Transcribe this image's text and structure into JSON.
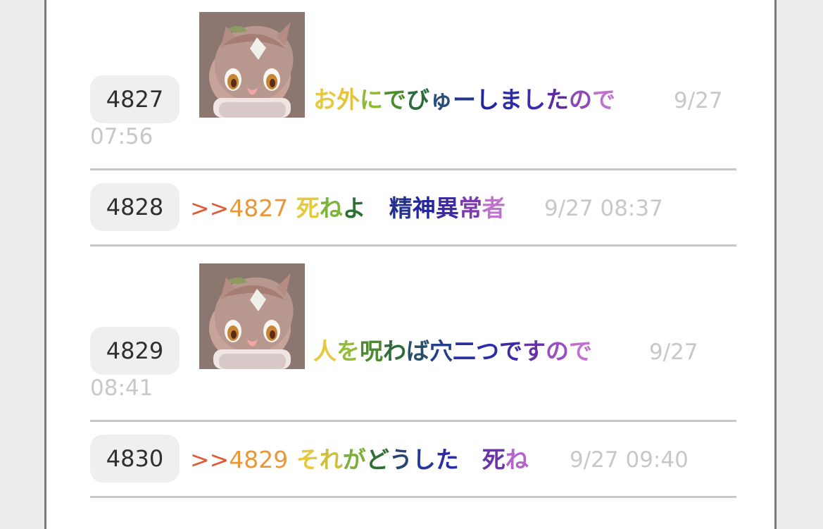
{
  "posts": [
    {
      "number": "4827",
      "text_chars": [
        {
          "t": "お",
          "c": "#e6c93d"
        },
        {
          "t": "外",
          "c": "#e3c43a"
        },
        {
          "t": "に",
          "c": "#8cbc35"
        },
        {
          "t": "で",
          "c": "#4d8d2d"
        },
        {
          "t": "び",
          "c": "#2b6a3a"
        },
        {
          "t": "ゅ",
          "c": "#2a4e7d"
        },
        {
          "t": "ー",
          "c": "#20358f"
        },
        {
          "t": "し",
          "c": "#2424a1"
        },
        {
          "t": "ま",
          "c": "#2c2ca6"
        },
        {
          "t": "し",
          "c": "#3a2ca8"
        },
        {
          "t": "た",
          "c": "#5c2ba2"
        },
        {
          "t": "の",
          "c": "#8e48b8"
        },
        {
          "t": "で",
          "c": "#c070cf"
        }
      ],
      "time_first_line": "9/27",
      "time_second_line": "07:56"
    },
    {
      "number": "4828",
      "reply_prefix": ">>",
      "reply_number": "4827",
      "text_chars": [
        {
          "t": "死",
          "c": "#e6c93d"
        },
        {
          "t": "ね",
          "c": "#7bb33b"
        },
        {
          "t": "よ",
          "c": "#2e6f34"
        },
        {
          "t": "　",
          "c": "#000000"
        },
        {
          "t": "精",
          "c": "#22308c"
        },
        {
          "t": "神",
          "c": "#25279f"
        },
        {
          "t": "異",
          "c": "#3f2aa6"
        },
        {
          "t": "常",
          "c": "#7b39ad"
        },
        {
          "t": "者",
          "c": "#c070cf"
        }
      ],
      "time": "9/27 08:37"
    },
    {
      "number": "4829",
      "text_chars": [
        {
          "t": "人",
          "c": "#e6c93d"
        },
        {
          "t": "を",
          "c": "#94bb36"
        },
        {
          "t": "呪",
          "c": "#4c8a31"
        },
        {
          "t": "わ",
          "c": "#2f6b3a"
        },
        {
          "t": "ば",
          "c": "#294f67"
        },
        {
          "t": "穴",
          "c": "#24408c"
        },
        {
          "t": "二",
          "c": "#2630a1"
        },
        {
          "t": "つ",
          "c": "#2b2ca6"
        },
        {
          "t": "で",
          "c": "#3d2aa5"
        },
        {
          "t": "す",
          "c": "#6533a7"
        },
        {
          "t": "の",
          "c": "#9a4fbe"
        },
        {
          "t": "で",
          "c": "#c070cf"
        }
      ],
      "time_first_line": "9/27",
      "time_second_line": "08:41"
    },
    {
      "number": "4830",
      "reply_prefix": ">>",
      "reply_number": "4829",
      "text_chars": [
        {
          "t": "そ",
          "c": "#e6c93d"
        },
        {
          "t": "れ",
          "c": "#cdbf39"
        },
        {
          "t": "が",
          "c": "#7cae39"
        },
        {
          "t": "ど",
          "c": "#2f6f36"
        },
        {
          "t": "う",
          "c": "#28466f"
        },
        {
          "t": "し",
          "c": "#23389b"
        },
        {
          "t": "た",
          "c": "#2b2ca6"
        },
        {
          "t": "　",
          "c": "#000000"
        },
        {
          "t": "死",
          "c": "#6b34a8"
        },
        {
          "t": "ね",
          "c": "#b564cb"
        }
      ],
      "time": "9/27 09:40"
    }
  ],
  "colors": {
    "background": "#ececec",
    "panel": "#ffffff",
    "panel_border": "#7b7b7b",
    "number_badge": "#efefef",
    "timestamp": "#c8c8c8",
    "divider": "#c7c7c7",
    "reply_arrow": "#df5a36",
    "reply_number": "#ea9736"
  }
}
